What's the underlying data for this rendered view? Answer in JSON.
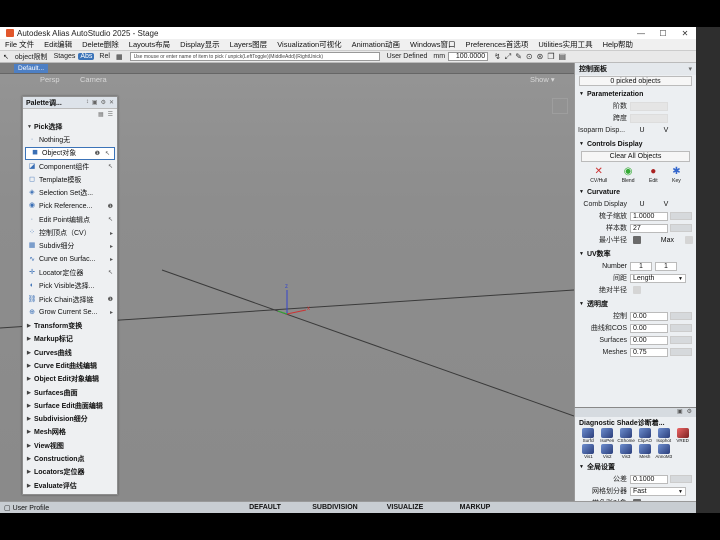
{
  "title": "Autodesk Alias AutoStudio 2025   - Stage",
  "window_controls": [
    "—",
    "☐",
    "✕"
  ],
  "menu": [
    "File 文件",
    "Edit编辑",
    "Delete删除",
    "Layouts布局",
    "Display显示",
    "Layers图层",
    "Visualization可视化",
    "Animation动画",
    "Windows窗口",
    "Preferences首选项",
    "Utilities实用工具",
    "Help帮助"
  ],
  "toolbar": {
    "object": "object限制",
    "stages": "Stages",
    "abs": "Abs",
    "rel": "Rel",
    "prompt": "Use mouse or enter name of item to pick / unpick(LeftToggle)(MiddleAdd)(RightUnick)",
    "user": "User Defined",
    "units": "mm",
    "tolerance": "100.0000"
  },
  "shelf": {
    "tab": "Default..."
  },
  "viewport": {
    "camera1": "Persp",
    "camera2": "Camera",
    "show": "Show ▾"
  },
  "palette": {
    "title": "Palette调...",
    "pick_section": "Pick选择",
    "tools": [
      {
        "label": "Nothing无",
        "icon": "·"
      },
      {
        "label": "Object对象",
        "icon": "◼",
        "m1": "❶",
        "m2": "↖"
      },
      {
        "label": "Component组件",
        "icon": "◪",
        "m2": "↖"
      },
      {
        "label": "Template模板",
        "icon": "◻"
      },
      {
        "label": "Selection Set选...",
        "icon": "◈"
      },
      {
        "label": "Pick Reference...",
        "icon": "◉",
        "m2": "❶"
      },
      {
        "label": "Edit Point编辑点",
        "icon": "∙",
        "m2": "↖"
      },
      {
        "label": "控制顶点（CV）",
        "icon": "⁘",
        "m2": "▸"
      },
      {
        "label": "Subdiv细分",
        "icon": "▦",
        "m2": "▸"
      },
      {
        "label": "Curve on Surfac...",
        "icon": "∿",
        "m2": "▸"
      },
      {
        "label": "Locator定位器",
        "icon": "✛",
        "m2": "↖"
      },
      {
        "label": "Pick Visible选择...",
        "icon": "◐"
      },
      {
        "label": "Pick Chain选择链",
        "icon": "⛓",
        "m2": "❶"
      },
      {
        "label": "Grow Current Se...",
        "icon": "⊕",
        "m2": "▸"
      }
    ],
    "categories": [
      "Transform变换",
      "Markup标记",
      "Curves曲线",
      "Curve Edit曲线编辑",
      "Object Edit对象编辑",
      "Surfaces曲面",
      "Surface Edit曲面编辑",
      "Subdivision细分",
      "Mesh网格",
      "View视图",
      "Construction点",
      "Locators定位器",
      "Evaluate评估"
    ]
  },
  "panel": {
    "title": "控制面板",
    "status": "0 picked objects",
    "param_title": "Parameterization",
    "param_rows": [
      "阶数",
      "跨度"
    ],
    "iso_label": "Isoparm Disp...",
    "iso_u": "U",
    "iso_v": "V",
    "controls_title": "Controls Display",
    "clear_all": "Clear All Objects",
    "cd_icons": [
      {
        "g": "✕",
        "t": "CV/Hull"
      },
      {
        "g": "◉",
        "t": "Blend"
      },
      {
        "g": "●",
        "t": "Edit"
      },
      {
        "g": "✱",
        "t": "Key"
      }
    ],
    "curvature_title": "Curvature",
    "comb_label": "Comb Display",
    "comb_u": "U",
    "comb_v": "V",
    "scale_label": "梳子缩放",
    "scale_val": "1.0000",
    "samples_label": "样本数",
    "samples_val": "27",
    "minrad_label": "最小半径",
    "max_label": "Max",
    "uv_title": "UV数率",
    "number_label": "Number",
    "number_u": "1",
    "number_v": "1",
    "dist_label": "间距",
    "dist_val": "Length",
    "abs_label": "绝对半径",
    "trans_title": "透明度",
    "trans_rows": [
      {
        "l": "控制",
        "v": "0.00"
      },
      {
        "l": "曲线和COS",
        "v": "0.00"
      },
      {
        "l": "Surfaces",
        "v": "0.00"
      },
      {
        "l": "Meshes",
        "v": "0.75"
      }
    ]
  },
  "diag": {
    "title": "Diagnostic Shade诊断着...",
    "shades": [
      "Surfcl",
      "IsoPen",
      "CShome",
      "ClipAO",
      "Isophot",
      "VRED",
      "Vis1",
      "Vis2",
      "Vis3",
      "Mesh",
      "AnnoM3"
    ],
    "global_title": "全局设置",
    "tol_label": "公差",
    "tol_val": "0.1000",
    "mesher_label": "网格划分器",
    "mesher_val": "Fast",
    "color_label": "带色彩对象"
  },
  "status": {
    "profile": "User Profile",
    "sets": [
      "DEFAULT",
      "SUBDIVISION",
      "VISUALIZE",
      "MARKUP"
    ]
  },
  "axis": {
    "z": "z",
    "x": "x"
  }
}
